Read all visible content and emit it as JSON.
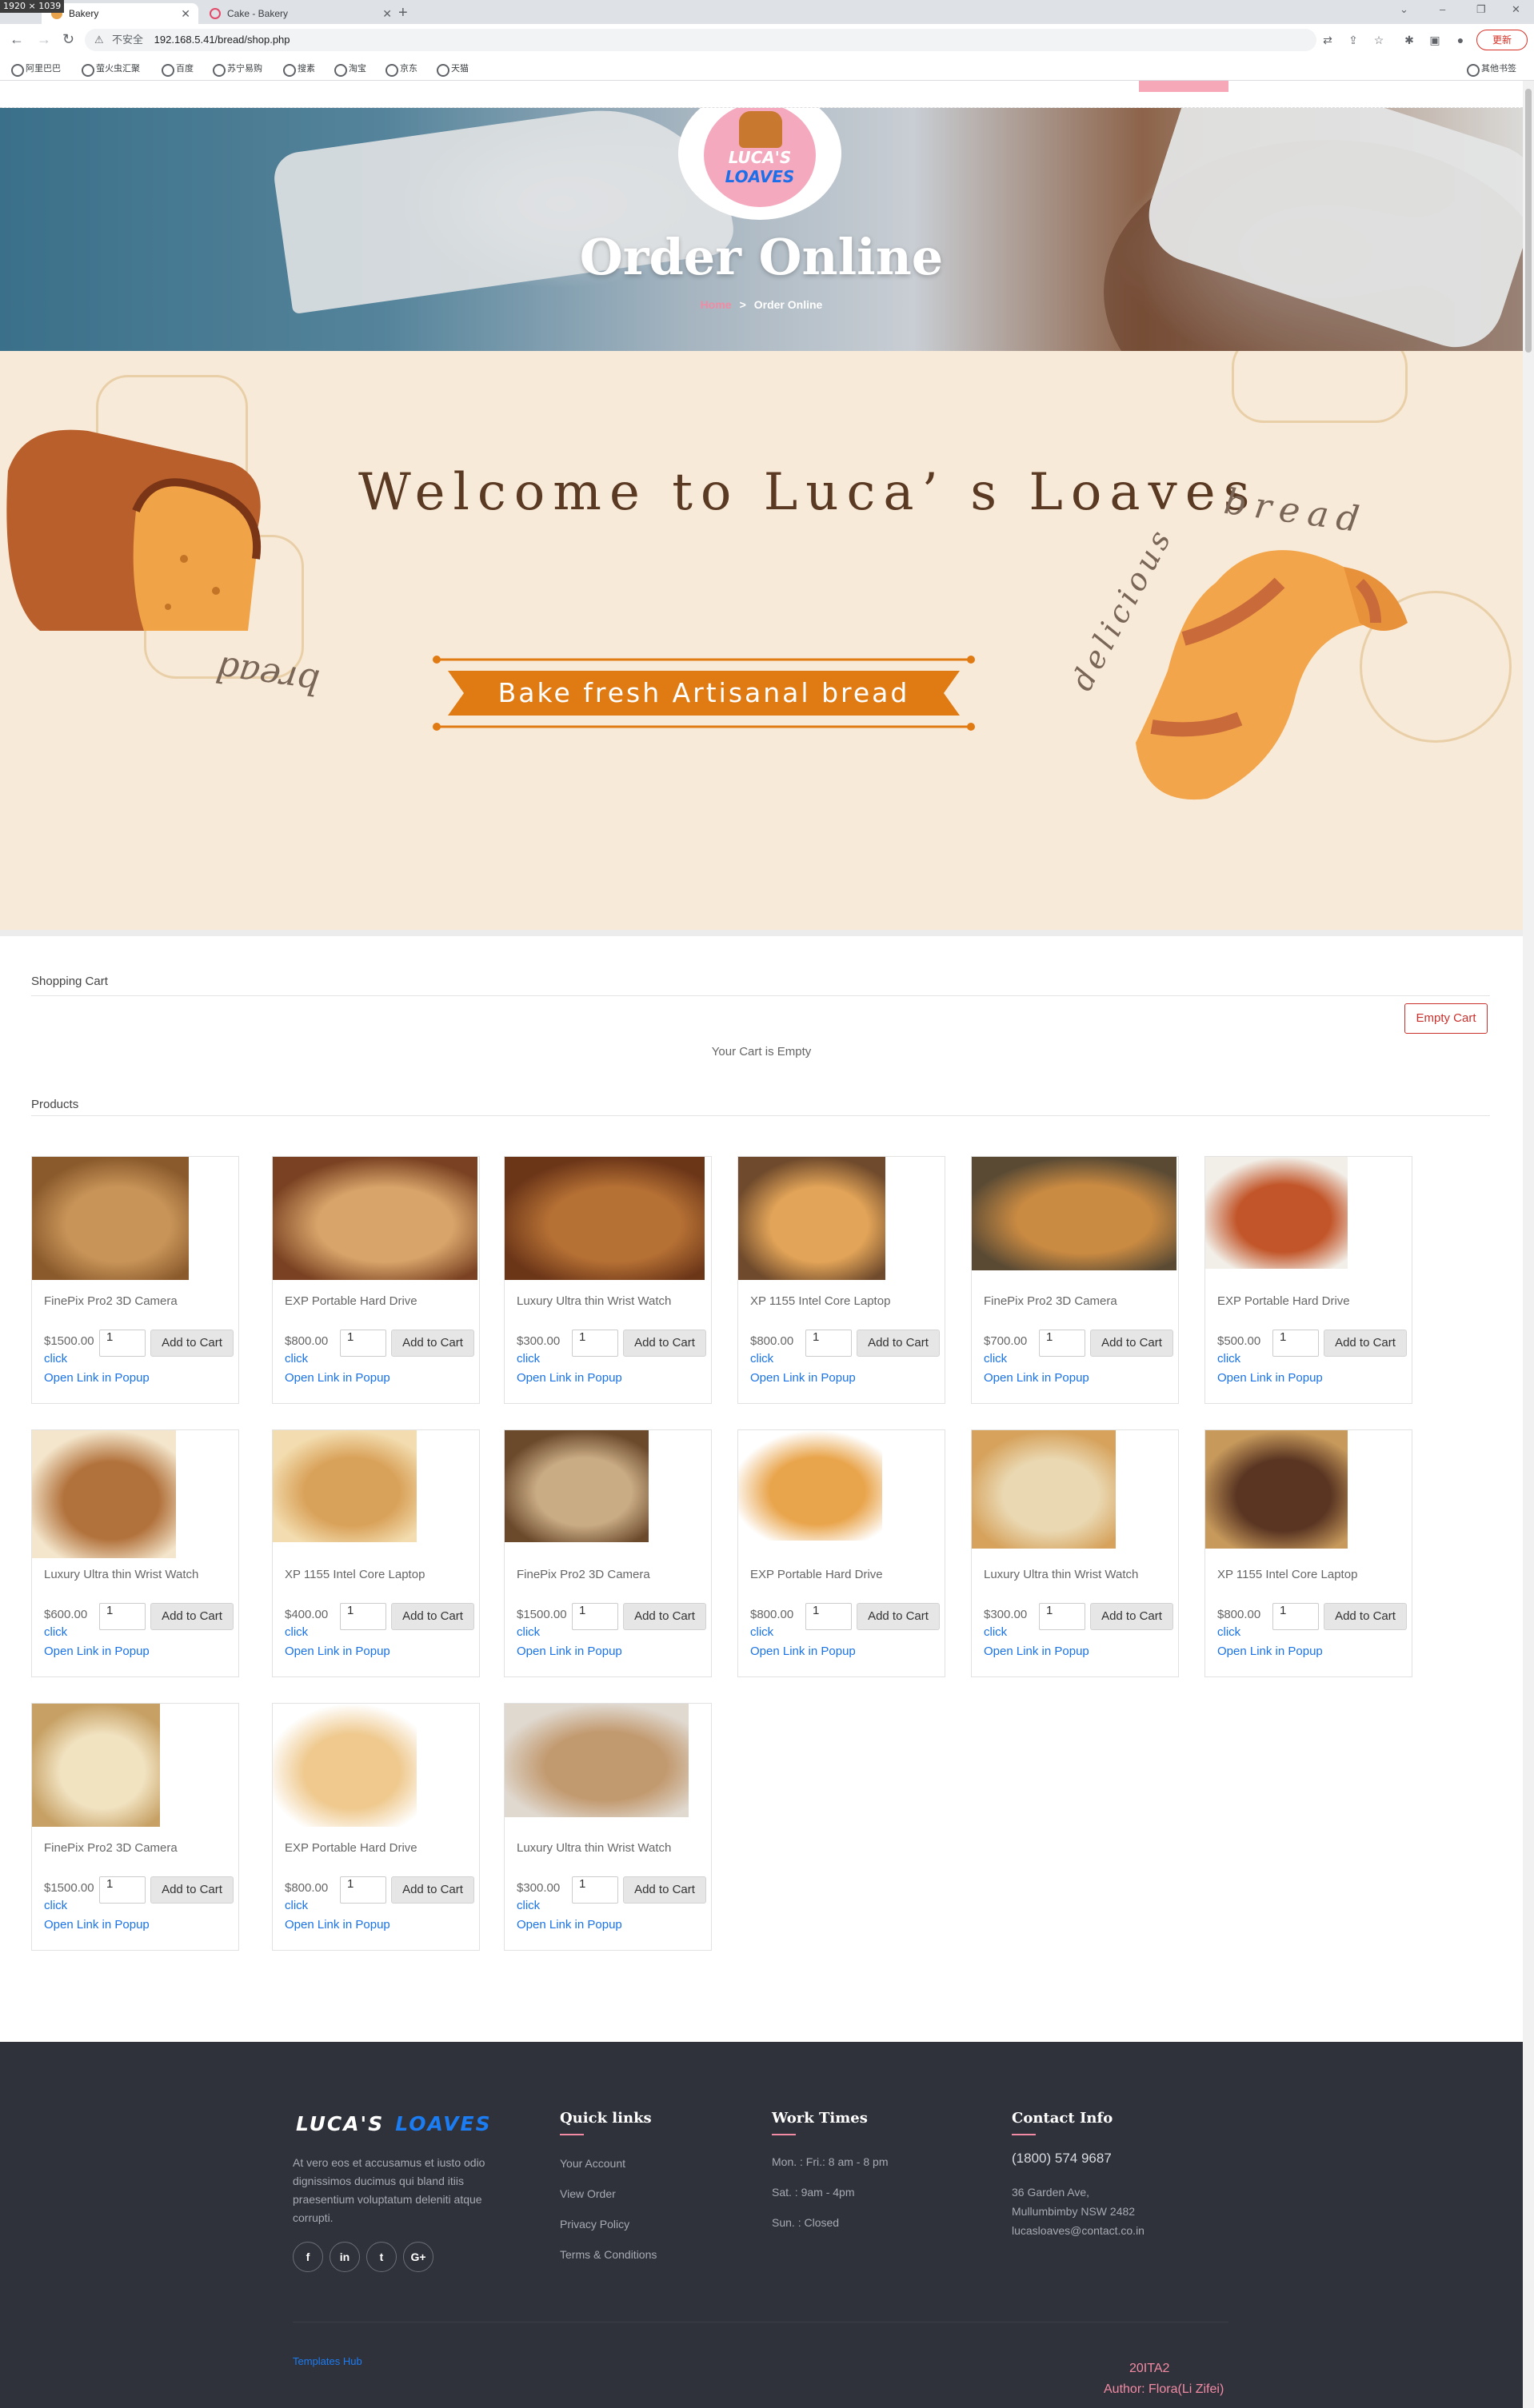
{
  "browser": {
    "screen_size": "1920 × 1039",
    "tabs": [
      {
        "title": "Bakery",
        "active": true
      },
      {
        "title": "Cake - Bakery",
        "active": false
      }
    ],
    "omnibox": {
      "security": "不安全",
      "url": "192.168.5.41/bread/shop.php"
    },
    "update_label": "更新",
    "bookmarks": [
      "阿里巴巴",
      "萤火虫汇聚",
      "百度",
      "苏宁易购",
      "搜素",
      "淘宝",
      "京东",
      "天猫"
    ],
    "other_bookmarks": "其他书签"
  },
  "banner": {
    "logo_line1": "LUCA'S",
    "logo_line2": "LOAVES",
    "title": "Order Online",
    "breadcrumb_home": "Home",
    "breadcrumb_sep": ">",
    "breadcrumb_current": "Order Online"
  },
  "hero": {
    "title": "Welcome to Luca’ s Loaves",
    "ribbon": "Bake fresh  Artisanal bread",
    "word_bread_left": "bread",
    "word_delicious": "delicious",
    "word_bread_right": "bread"
  },
  "cart": {
    "heading": "Shopping Cart",
    "empty_button": "Empty Cart",
    "empty_message": "Your Cart is Empty"
  },
  "products_heading": "Products",
  "products": [
    {
      "name": "FinePix Pro2 3D Camera",
      "price": "$1500.00",
      "qty": "1",
      "add": "Add to Cart",
      "click": "click",
      "popup": "Open Link in Popup",
      "img": "round rolls"
    },
    {
      "name": "EXP Portable Hard Drive",
      "price": "$800.00",
      "qty": "1",
      "add": "Add to Cart",
      "click": "click",
      "popup": "Open Link in Popup",
      "img": "sliced loaf"
    },
    {
      "name": "Luxury Ultra thin Wrist Watch",
      "price": "$300.00",
      "qty": "1",
      "add": "Add to Cart",
      "click": "click",
      "popup": "Open Link in Popup",
      "img": "rustic bread"
    },
    {
      "name": "XP 1155 Intel Core Laptop",
      "price": "$800.00",
      "qty": "1",
      "add": "Add to Cart",
      "click": "click",
      "popup": "Open Link in Popup",
      "img": "baguettes"
    },
    {
      "name": "FinePix Pro2 3D Camera",
      "price": "$700.00",
      "qty": "1",
      "add": "Add to Cart",
      "click": "click",
      "popup": "Open Link in Popup",
      "img": "boule"
    },
    {
      "name": "EXP Portable Hard Drive",
      "price": "$500.00",
      "qty": "1",
      "add": "Add to Cart",
      "click": "click",
      "popup": "Open Link in Popup",
      "img": "challah"
    },
    {
      "name": "Luxury Ultra thin Wrist Watch",
      "price": "$600.00",
      "qty": "1",
      "add": "Add to Cart",
      "click": "click",
      "popup": "Open Link in Popup",
      "img": "sliced rye"
    },
    {
      "name": "XP 1155 Intel Core Laptop",
      "price": "$400.00",
      "qty": "1",
      "add": "Add to Cart",
      "click": "click",
      "popup": "Open Link in Popup",
      "img": "bread cut"
    },
    {
      "name": "FinePix Pro2 3D Camera",
      "price": "$1500.00",
      "qty": "1",
      "add": "Add to Cart",
      "click": "click",
      "popup": "Open Link in Popup",
      "img": "sourdough slices"
    },
    {
      "name": "EXP Portable Hard Drive",
      "price": "$800.00",
      "qty": "1",
      "add": "Add to Cart",
      "click": "click",
      "popup": "Open Link in Popup",
      "img": "baguette"
    },
    {
      "name": "Luxury Ultra thin Wrist Watch",
      "price": "$300.00",
      "qty": "1",
      "add": "Add to Cart",
      "click": "click",
      "popup": "Open Link in Popup",
      "img": "sliced white"
    },
    {
      "name": "XP 1155 Intel Core Laptop",
      "price": "$800.00",
      "qty": "1",
      "add": "Add to Cart",
      "click": "click",
      "popup": "Open Link in Popup",
      "img": "dark rye"
    },
    {
      "name": "FinePix Pro2 3D Camera",
      "price": "$1500.00",
      "qty": "1",
      "add": "Add to Cart",
      "click": "click",
      "popup": "Open Link in Popup",
      "img": "white loaf"
    },
    {
      "name": "EXP Portable Hard Drive",
      "price": "$800.00",
      "qty": "1",
      "add": "Add to Cart",
      "click": "click",
      "popup": "Open Link in Popup",
      "img": "pita stack"
    },
    {
      "name": "Luxury Ultra thin Wrist Watch",
      "price": "$300.00",
      "qty": "1",
      "add": "Add to Cart",
      "click": "click",
      "popup": "Open Link in Popup",
      "img": "ciabatta"
    }
  ],
  "footer": {
    "logo_a": "LUCA'S",
    "logo_b": "LOAVES",
    "about": "At vero eos et accusamus et iusto odio dignissimos ducimus qui bland itiis praesentium voluptatum deleniti atque corrupti.",
    "social": [
      "f",
      "in",
      "t",
      "G+"
    ],
    "quick_links_heading": "Quick links",
    "quick_links": [
      "Your Account",
      "View Order",
      "Privacy Policy",
      "Terms & Conditions"
    ],
    "work_times_heading": "Work Times",
    "work_times": [
      "Mon. : Fri.: 8 am - 8 pm",
      "Sat. : 9am - 4pm",
      "Sun. : Closed"
    ],
    "contact_heading": "Contact Info",
    "phone": "(1800) 574 9687",
    "address": [
      "36 Garden Ave,",
      "Mullumbimby NSW 2482",
      "lucasloaves@contact.co.in"
    ],
    "templates_link": "Templates Hub",
    "credit_line1": "20ITA2",
    "credit_line2": "Author: Flora(Li Zifei)"
  },
  "colors": {
    "accent_pink": "#f28aa3",
    "brand_blue": "#1c7cf2",
    "hero_bg": "#f8ead8",
    "ribbon_orange": "#e07b14",
    "footer_bg": "#2f323b",
    "link_blue": "#1a73e8",
    "danger_red": "#c9302c"
  }
}
